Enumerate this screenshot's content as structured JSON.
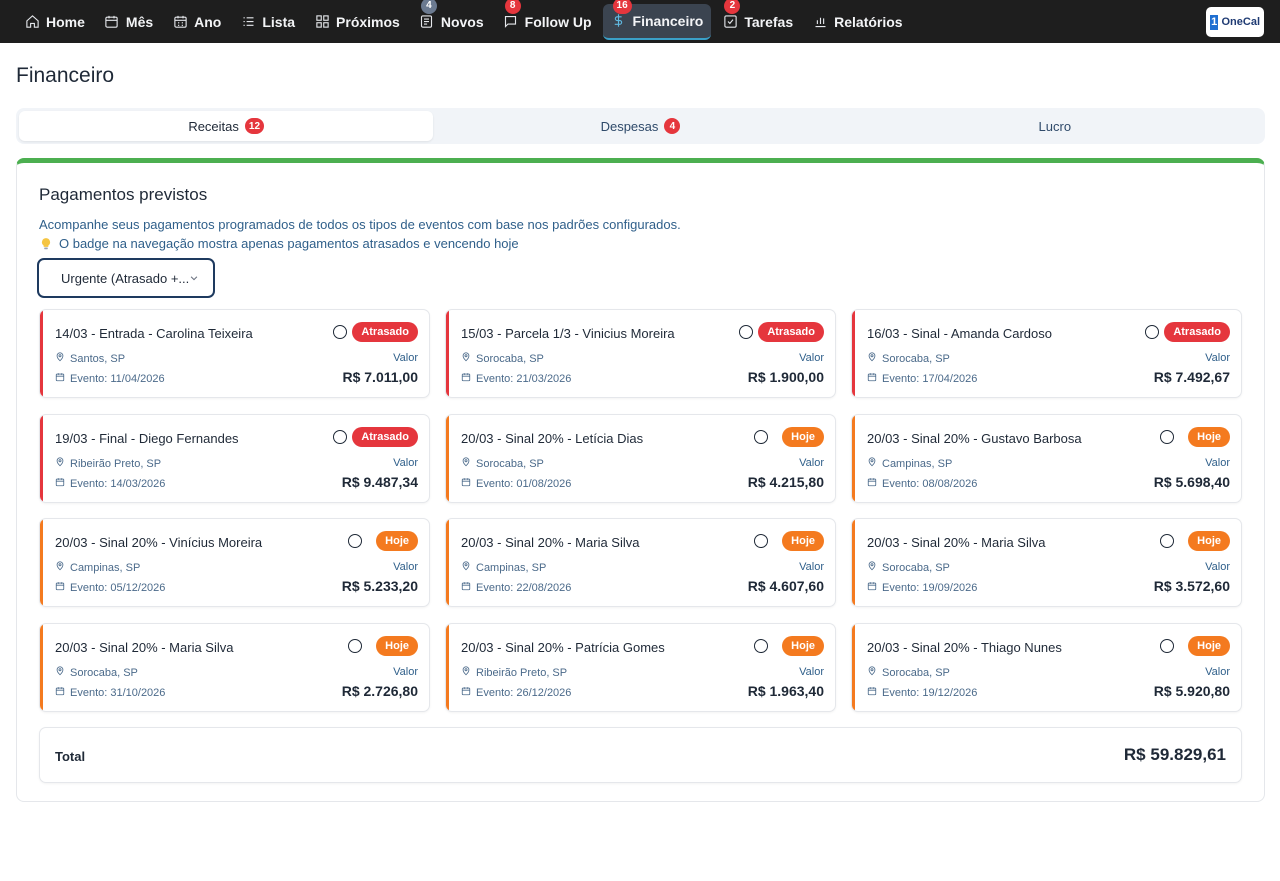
{
  "nav": {
    "items": [
      {
        "label": "Home",
        "icon": "home-icon",
        "badge": null
      },
      {
        "label": "Mês",
        "icon": "calendar-icon",
        "badge": null
      },
      {
        "label": "Ano",
        "icon": "calendar-grid-icon",
        "badge": null
      },
      {
        "label": "Lista",
        "icon": "list-icon",
        "badge": null
      },
      {
        "label": "Próximos",
        "icon": "grid-icon",
        "badge": null
      },
      {
        "label": "Novos",
        "icon": "inbox-icon",
        "badge": "4"
      },
      {
        "label": "Follow Up",
        "icon": "chat-icon",
        "badge": "8"
      },
      {
        "label": "Financeiro",
        "icon": "dollar-icon",
        "badge": "16"
      },
      {
        "label": "Tarefas",
        "icon": "checkbox-icon",
        "badge": "2"
      },
      {
        "label": "Relatórios",
        "icon": "bar-chart-icon",
        "badge": null
      }
    ],
    "logo": {
      "mark": "1",
      "text": "OneCal"
    }
  },
  "page": {
    "title": "Financeiro"
  },
  "tabs": [
    {
      "label": "Receitas",
      "badge": "12"
    },
    {
      "label": "Despesas",
      "badge": "4"
    },
    {
      "label": "Lucro",
      "badge": null
    }
  ],
  "panel": {
    "title": "Pagamentos previstos",
    "description": "Acompanhe seus pagamentos programados de todos os tipos de eventos com base nos padrões configurados.",
    "hint": "O badge na navegação mostra apenas pagamentos atrasados e vencendo hoje",
    "filter": "Urgente (Atrasado +..."
  },
  "colors": {
    "overdue": "#e5363d",
    "today": "#f47a1f",
    "accent_bar": "#4caf50"
  },
  "value_label": "Valor",
  "cards": [
    {
      "title": "14/03 - Entrada - Carolina Teixeira",
      "status": "Atrasado",
      "location": "Santos, SP",
      "event_date": "Evento: 11/04/2026",
      "amount": "R$ 7.011,00"
    },
    {
      "title": "15/03 - Parcela 1/3 - Vinicius Moreira",
      "status": "Atrasado",
      "location": "Sorocaba, SP",
      "event_date": "Evento: 21/03/2026",
      "amount": "R$ 1.900,00"
    },
    {
      "title": "16/03 - Sinal - Amanda Cardoso",
      "status": "Atrasado",
      "location": "Sorocaba, SP",
      "event_date": "Evento: 17/04/2026",
      "amount": "R$ 7.492,67"
    },
    {
      "title": "19/03 - Final - Diego Fernandes",
      "status": "Atrasado",
      "location": "Ribeirão Preto, SP",
      "event_date": "Evento: 14/03/2026",
      "amount": "R$ 9.487,34"
    },
    {
      "title": "20/03 - Sinal 20% - Letícia Dias",
      "status": "Hoje",
      "location": "Sorocaba, SP",
      "event_date": "Evento: 01/08/2026",
      "amount": "R$ 4.215,80"
    },
    {
      "title": "20/03 - Sinal 20% - Gustavo Barbosa",
      "status": "Hoje",
      "location": "Campinas, SP",
      "event_date": "Evento: 08/08/2026",
      "amount": "R$ 5.698,40"
    },
    {
      "title": "20/03 - Sinal 20% - Vinícius Moreira",
      "status": "Hoje",
      "location": "Campinas, SP",
      "event_date": "Evento: 05/12/2026",
      "amount": "R$ 5.233,20"
    },
    {
      "title": "20/03 - Sinal 20% - Maria Silva",
      "status": "Hoje",
      "location": "Campinas, SP",
      "event_date": "Evento: 22/08/2026",
      "amount": "R$ 4.607,60"
    },
    {
      "title": "20/03 - Sinal 20% - Maria Silva",
      "status": "Hoje",
      "location": "Sorocaba, SP",
      "event_date": "Evento: 19/09/2026",
      "amount": "R$ 3.572,60"
    },
    {
      "title": "20/03 - Sinal 20% - Maria Silva",
      "status": "Hoje",
      "location": "Sorocaba, SP",
      "event_date": "Evento: 31/10/2026",
      "amount": "R$ 2.726,80"
    },
    {
      "title": "20/03 - Sinal 20% - Patrícia Gomes",
      "status": "Hoje",
      "location": "Ribeirão Preto, SP",
      "event_date": "Evento: 26/12/2026",
      "amount": "R$ 1.963,40"
    },
    {
      "title": "20/03 - Sinal 20% - Thiago Nunes",
      "status": "Hoje",
      "location": "Sorocaba, SP",
      "event_date": "Evento: 19/12/2026",
      "amount": "R$ 5.920,80"
    }
  ],
  "total": {
    "label": "Total",
    "amount": "R$ 59.829,61"
  }
}
